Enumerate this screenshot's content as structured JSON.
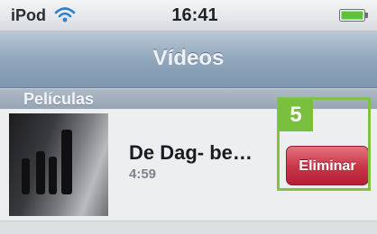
{
  "status_bar": {
    "carrier": "iPod",
    "time": "16:41",
    "wifi_icon": "wifi-icon",
    "battery_icon": "battery-icon"
  },
  "nav_bar": {
    "title": "Vídeos"
  },
  "section": {
    "label": "Películas"
  },
  "video_row": {
    "title": "De Dag- be…",
    "duration": "4:59",
    "delete_label": "Eliminar"
  },
  "annotation": {
    "step_number": "5",
    "accent_color": "#7dc346"
  },
  "colors": {
    "nav_bar": "#8ea4ba",
    "delete_button": "#c8364a"
  }
}
